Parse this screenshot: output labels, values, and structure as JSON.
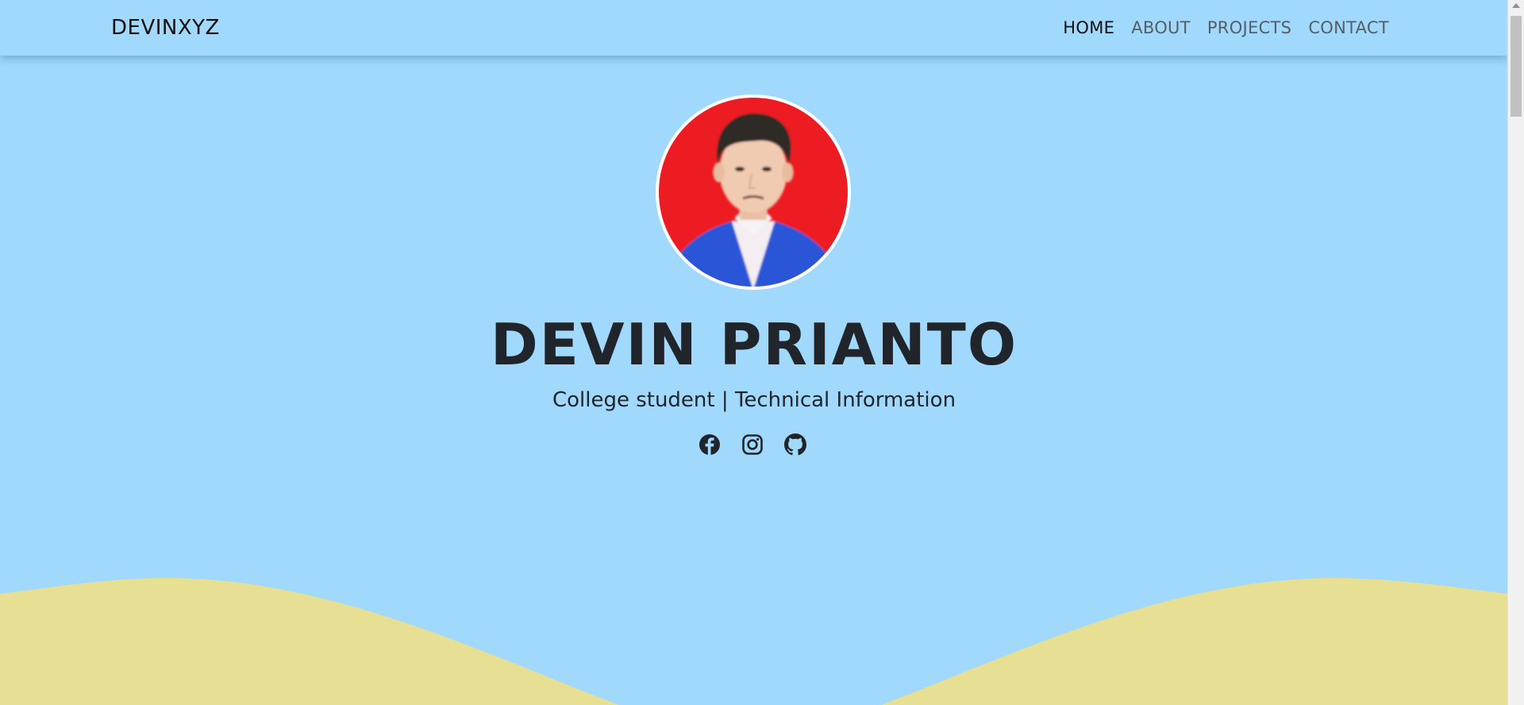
{
  "brand": "DEVINXYZ",
  "nav": {
    "home": "HOME",
    "about": "ABOUT",
    "projects": "PROJECTS",
    "contact": "CONTACT",
    "active": "home"
  },
  "hero": {
    "name": "DEVIN PRIANTO",
    "subtitle": "College student | Technical Information",
    "avatar_alt": "profile photo"
  },
  "socials": [
    {
      "icon": "facebook-icon"
    },
    {
      "icon": "instagram-icon"
    },
    {
      "icon": "github-icon"
    }
  ],
  "colors": {
    "background": "#a1d9fd",
    "wave": "#e7df93",
    "text": "#20252b",
    "nav_inactive": "#555e66",
    "avatar_bg": "#ed1c24",
    "jacket": "#2a55d6"
  }
}
